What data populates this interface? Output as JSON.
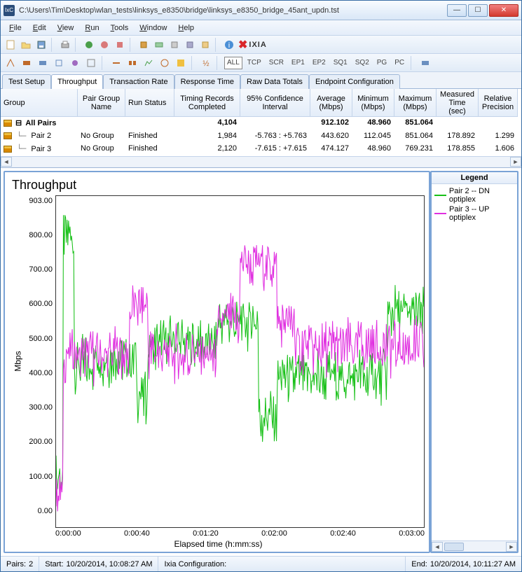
{
  "window": {
    "app_icon_text": "IxC",
    "title": "C:\\Users\\Tim\\Desktop\\wlan_tests\\linksys_e8350\\bridge\\linksys_e8350_bridge_45ant_updn.tst"
  },
  "menu": {
    "file": "File",
    "edit": "Edit",
    "view": "View",
    "run": "Run",
    "tools": "Tools",
    "window": "Window",
    "help": "Help"
  },
  "logo": {
    "text": "IXIA"
  },
  "toolbar2": {
    "all": "ALL",
    "tcp": "TCP",
    "scr": "SCR",
    "ep1": "EP1",
    "ep2": "EP2",
    "sq1": "SQ1",
    "sq2": "SQ2",
    "pg": "PG",
    "pc": "PC"
  },
  "tabs": {
    "test_setup": "Test Setup",
    "throughput": "Throughput",
    "transaction_rate": "Transaction Rate",
    "response_time": "Response Time",
    "raw_data_totals": "Raw Data Totals",
    "endpoint_config": "Endpoint Configuration"
  },
  "grid": {
    "headers": {
      "group": "Group",
      "pair_group_name": "Pair Group Name",
      "run_status": "Run Status",
      "timing_records": "Timing Records Completed",
      "ci": "95% Confidence Interval",
      "avg": "Average (Mbps)",
      "min": "Minimum (Mbps)",
      "max": "Maximum (Mbps)",
      "meas": "Measured Time (sec)",
      "rel": "Relative Precision"
    },
    "rows": [
      {
        "group": "All Pairs",
        "pair_group": "",
        "status": "",
        "records": "4,104",
        "ci": "",
        "avg": "912.102",
        "min": "48.960",
        "max": "851.064",
        "meas": "",
        "rel": "",
        "bold": true
      },
      {
        "group": "Pair 2",
        "pair_group": "No Group",
        "status": "Finished",
        "records": "1,984",
        "ci": "-5.763 : +5.763",
        "avg": "443.620",
        "min": "112.045",
        "max": "851.064",
        "meas": "178.892",
        "rel": "1.299"
      },
      {
        "group": "Pair 3",
        "pair_group": "No Group",
        "status": "Finished",
        "records": "2,120",
        "ci": "-7.615 : +7.615",
        "avg": "474.127",
        "min": "48.960",
        "max": "769.231",
        "meas": "178.855",
        "rel": "1.606"
      }
    ]
  },
  "chart_data": {
    "type": "line",
    "title": "Throughput",
    "xlabel": "Elapsed time (h:mm:ss)",
    "ylabel": "Mbps",
    "ylim": [
      0,
      903
    ],
    "yticks": [
      "903.00",
      "800.00",
      "700.00",
      "600.00",
      "500.00",
      "400.00",
      "300.00",
      "200.00",
      "100.00",
      "0.00"
    ],
    "xticks": [
      "0:00:00",
      "0:00:40",
      "0:01:20",
      "0:02:00",
      "0:02:40",
      "0:03:00"
    ],
    "xrange_seconds": [
      0,
      180
    ],
    "series": [
      {
        "name": "Pair 2 -- DN optiplex",
        "color": "#18c018",
        "avg": 443.62,
        "min": 112.045,
        "max": 851.064
      },
      {
        "name": "Pair 3 -- UP optiplex",
        "color": "#e030e0",
        "avg": 474.127,
        "min": 48.96,
        "max": 769.231
      }
    ],
    "legend_title": "Legend"
  },
  "status": {
    "pairs_label": "Pairs:",
    "pairs_value": "2",
    "start_label": "Start:",
    "start_value": "10/20/2014, 10:08:27 AM",
    "config_label": "Ixia Configuration:",
    "end_label": "End:",
    "end_value": "10/20/2014, 10:11:27 AM"
  }
}
